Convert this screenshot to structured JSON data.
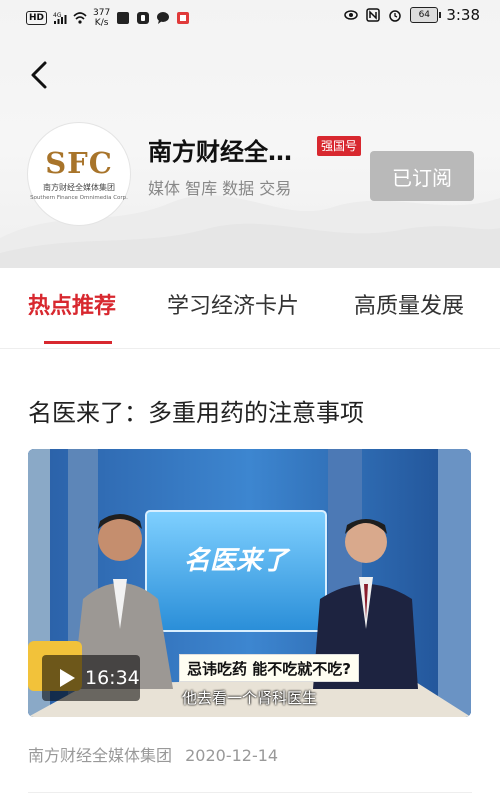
{
  "status_bar": {
    "left_badges": [
      "HD",
      "4G"
    ],
    "speed_value": "377",
    "speed_unit": "K/s",
    "battery": "64",
    "time": "3:38"
  },
  "channel": {
    "name": "南方财经全…",
    "badge": "强国号",
    "tags": "媒体 智库 数据 交易",
    "logo_mark": "SFC",
    "logo_cn": "南方财经全媒体集团",
    "logo_en": "Southern Finance Omnimedia Corp.",
    "subscribe_label": "已订阅"
  },
  "tabs": [
    {
      "label": "热点推荐",
      "active": true
    },
    {
      "label": "学习经济卡片",
      "active": false
    },
    {
      "label": "高质量发展",
      "active": false
    }
  ],
  "article": {
    "title": "名医来了：多重用药的注意事项",
    "video": {
      "duration": "16:34",
      "caption": "忌讳吃药 能不吃就不吃?",
      "subtitle": "他去看一个肾科医生",
      "screen_text": "名医来了"
    },
    "source": "南方财经全媒体集团",
    "date": "2020-12-14"
  },
  "colors": {
    "accent": "#d8282f",
    "subscribe_bg": "#b9b9b9",
    "logo_gold": "#a8742a"
  }
}
